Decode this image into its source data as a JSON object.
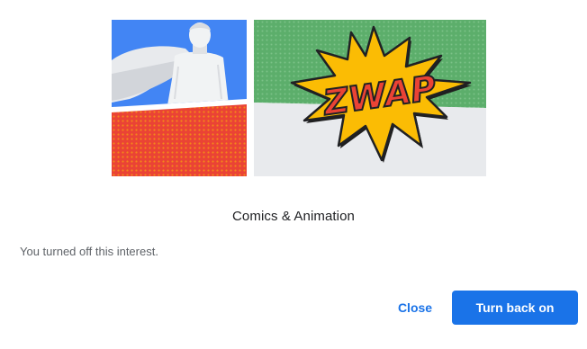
{
  "illustration": {
    "icon": "comics-illustration",
    "burst_text": "ZWAP",
    "colors": {
      "blue": "#4285f4",
      "red": "#ea4335",
      "green": "#5cae6b",
      "yellow": "#fbbc04",
      "gray": "#e8eaed"
    }
  },
  "topic": {
    "title": "Comics & Animation"
  },
  "status": {
    "text": "You turned off this interest."
  },
  "actions": {
    "close_label": "Close",
    "turn_on_label": "Turn back on",
    "accent_color": "#1a73e8"
  }
}
